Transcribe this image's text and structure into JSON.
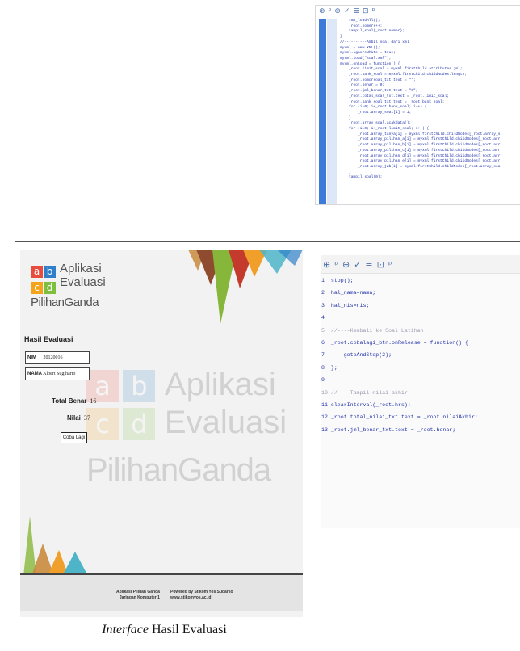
{
  "code_top": {
    "toolbar_icons": [
      "⊕",
      "ᵖ",
      "⊕",
      "✓",
      "≣",
      "⊡",
      "ᵖ"
    ],
    "lines": [
      "    tmp_loadAll();",
      "    _root.nomers++;",
      "    tampil_soal(_root.nomer);",
      "}",
      "//----------Ambil soal dari xml",
      "myxml = new XML();",
      "myxml.ignoreWhite = true;",
      "myxml.load(\"soal.xml\");",
      "myxml.onLoad = function() {",
      "    _root.limit_soal = myxml.firstChild.attributes.jml;",
      "    _root.bank_soal = myxml.firstChild.childNodes.length;",
      "    _root.nomorsoal_txt.text = \"\";",
      "    _root.benar = 0;",
      "    _root.jml_benar_txt.text = \"0\";",
      "    _root.total_soal_txt.text = _root.limit_soal;",
      "    _root.bank_soal_txt.text = _root.bank_soal;",
      "    for (i=0; i<_root.bank_soal; i++) {",
      "        _root.array_soal[i] = i;",
      "    }",
      "    _root.array_soal.acakdata();",
      "    for (i=0; i<_root.limit_soal; i++) {",
      "        _root.array_tanya[i] = myxml.firstChild.childNodes[_root.array_s",
      "        _root.array_pilihan_a[i] = myxml.firstChild.childNodes[_root.arr",
      "        _root.array_pilihan_b[i] = myxml.firstChild.childNodes[_root.arr",
      "        _root.array_pilihan_c[i] = myxml.firstChild.childNodes[_root.arr",
      "        _root.array_pilihan_d[i] = myxml.firstChild.childNodes[_root.arr",
      "        _root.array_pilihan_e[i] = myxml.firstChild.childNodes[_root.arr",
      "        _root.array_jwb[i] = myxml.firstChild.childNodes[_root.array_soa",
      "    }",
      "    tampil_soal(0);"
    ]
  },
  "code_bottom": {
    "toolbar_icons": [
      "⊕",
      "ᵖ",
      "⊕",
      "✓",
      "≣",
      "⊡",
      "ᵖ"
    ],
    "lines": [
      "1  stop();",
      "2  hal_nama=nama;",
      "3  hal_nis=nis;",
      "4",
      "5  //----Kembali ke Soal Latihan",
      "6  _root.cobalagi_btn.onRelease = function() {",
      "7      gotoAndStop(2);",
      "8  };",
      "9",
      "10 //----Tampil nilai akhir",
      "11 clearInterval(_root.hrs);",
      "12 _root.total_nilai_txt.text = _root.nilaiAkhir;",
      "13 _root.jml_benar_txt.text = _root.benar;"
    ]
  },
  "app": {
    "logo": {
      "letters": [
        "a",
        "b",
        "c",
        "d"
      ],
      "line1": "Aplikasi",
      "line2": "Evaluasi",
      "line3": "PilihanGanda"
    },
    "heading": "Hasil Evaluasi",
    "nim_label": "NIM",
    "nim_value": "20120016",
    "nama_label": "NAMA",
    "nama_value": "Albert Sugiharto",
    "total_benar_label": "Total Benar",
    "total_benar_value": "16",
    "nilai_label": "Nilai",
    "nilai_value": "37",
    "button_label": "Coba Lagi",
    "footer_left_1": "Aplikasi Pilihan Ganda",
    "footer_left_2": "Jaringan Komputer 1",
    "footer_right_1": "Powered by Stikom Yos Sudarso",
    "footer_right_2": "www.stikomyos.ac.id",
    "colors": {
      "a": "#e84c3d",
      "b": "#2f80c9",
      "c": "#f3a41a",
      "d": "#7fbf3f"
    }
  },
  "caption": {
    "italic": "Interface",
    "rest": "Hasil Evaluasi"
  }
}
